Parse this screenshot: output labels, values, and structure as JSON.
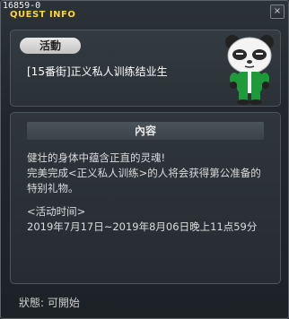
{
  "window": {
    "quest_id": "16859-0",
    "title": "QUEST INFO",
    "close_label": "×"
  },
  "event": {
    "tag": "活動",
    "quest_name": "[15番街]正义私人训练结业生"
  },
  "content": {
    "header": "內容",
    "line1": "健壮的身体中蕴含正直的灵魂!",
    "line2": "完美完成<正义私人训练>的人将会获得第公准备的",
    "line3": "特别礼物。",
    "period_label": "<活动时间>",
    "period_value": "2019年7月17日~2019年8月06日晚上11点59分"
  },
  "status": {
    "text": "狀態: 可開始"
  }
}
